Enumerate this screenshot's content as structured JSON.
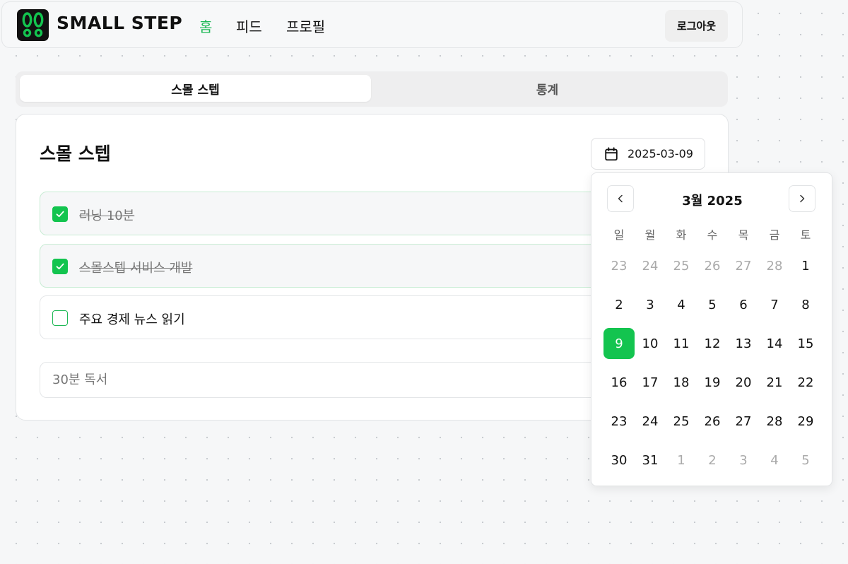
{
  "header": {
    "brand": "SMALL STEP",
    "nav": [
      {
        "label": "홈",
        "active": true
      },
      {
        "label": "피드",
        "active": false
      },
      {
        "label": "프로필",
        "active": false
      }
    ],
    "logout_label": "로그아웃",
    "logo_icon": "footprints-icon"
  },
  "tabs": [
    {
      "label": "스몰 스텝",
      "active": true
    },
    {
      "label": "통계",
      "active": false
    }
  ],
  "card": {
    "title": "스몰 스텝",
    "date": "2025-03-09",
    "tasks": [
      {
        "label": "러닝 10분",
        "done": true
      },
      {
        "label": "스몰스텝 서비스 개발",
        "done": true
      },
      {
        "label": "주요 경제 뉴스 읽기",
        "done": false
      }
    ],
    "new_task_placeholder": "30분 독서"
  },
  "calendar": {
    "title": "3월 2025",
    "weekdays": [
      "일",
      "월",
      "화",
      "수",
      "목",
      "금",
      "토"
    ],
    "weeks": [
      [
        "23",
        "24",
        "25",
        "26",
        "27",
        "28",
        "1"
      ],
      [
        "2",
        "3",
        "4",
        "5",
        "6",
        "7",
        "8"
      ],
      [
        "9",
        "10",
        "11",
        "12",
        "13",
        "14",
        "15"
      ],
      [
        "16",
        "17",
        "18",
        "19",
        "20",
        "21",
        "22"
      ],
      [
        "23",
        "24",
        "25",
        "26",
        "27",
        "28",
        "29"
      ],
      [
        "30",
        "31",
        "1",
        "2",
        "3",
        "4",
        "5"
      ]
    ],
    "selected_day": "9"
  },
  "colors": {
    "accent": "#13c44f",
    "nav_active": "#1fb856"
  }
}
